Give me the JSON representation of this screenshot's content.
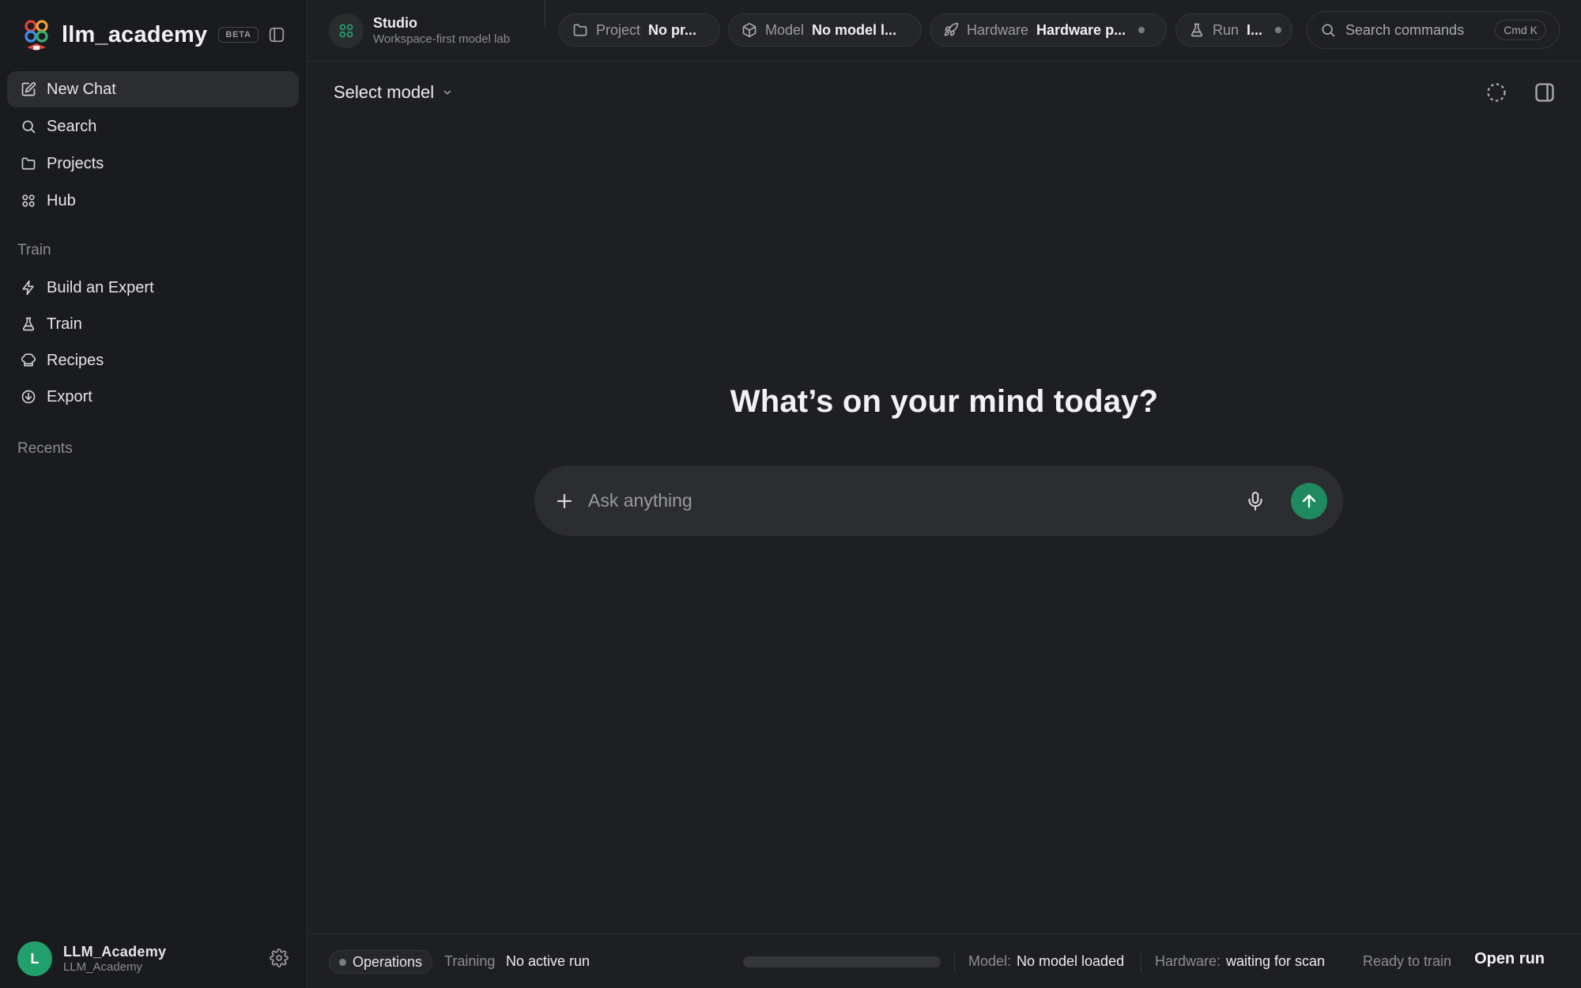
{
  "brand": {
    "name": "llm_academy",
    "badge": "BETA"
  },
  "sidebar": {
    "primary": [
      {
        "label": "New Chat",
        "icon": "edit-icon",
        "active": true
      },
      {
        "label": "Search",
        "icon": "search-icon"
      },
      {
        "label": "Projects",
        "icon": "folder-icon"
      },
      {
        "label": "Hub",
        "icon": "grid-icon"
      }
    ],
    "train_section_label": "Train",
    "train": [
      {
        "label": "Build an Expert",
        "icon": "bolt-icon"
      },
      {
        "label": "Train",
        "icon": "flask-icon"
      },
      {
        "label": "Recipes",
        "icon": "chef-hat-icon"
      },
      {
        "label": "Export",
        "icon": "download-icon"
      }
    ],
    "recents_label": "Recents"
  },
  "user": {
    "initial": "L",
    "name": "LLM_Academy",
    "handle": "LLM_Academy"
  },
  "topbar": {
    "studio_title": "Studio",
    "studio_subtitle": "Workspace-first model lab",
    "chips": {
      "project": {
        "key": "Project",
        "value": "No pr..."
      },
      "model": {
        "key": "Model",
        "value": "No model l..."
      },
      "hardware": {
        "key": "Hardware",
        "value": "Hardware p..."
      },
      "run": {
        "key": "Run",
        "value": "I..."
      }
    },
    "search_placeholder": "Search commands",
    "search_shortcut": "Cmd K"
  },
  "main": {
    "model_select": "Select model",
    "headline": "What’s on your mind today?",
    "composer_placeholder": "Ask anything"
  },
  "statusbar": {
    "ops_label": "Operations",
    "training_label": "Training",
    "training_value": "No active run",
    "progress": 0,
    "model_label": "Model:",
    "model_value": "No model loaded",
    "hardware_label": "Hardware:",
    "hardware_value": "waiting for scan",
    "ready": "Ready to train",
    "open_run": "Open run"
  },
  "colors": {
    "accent": "#22a06b",
    "send_button": "#1f8a5f",
    "background": "#1e1f22",
    "sidebar_background": "#1a1b1e"
  }
}
